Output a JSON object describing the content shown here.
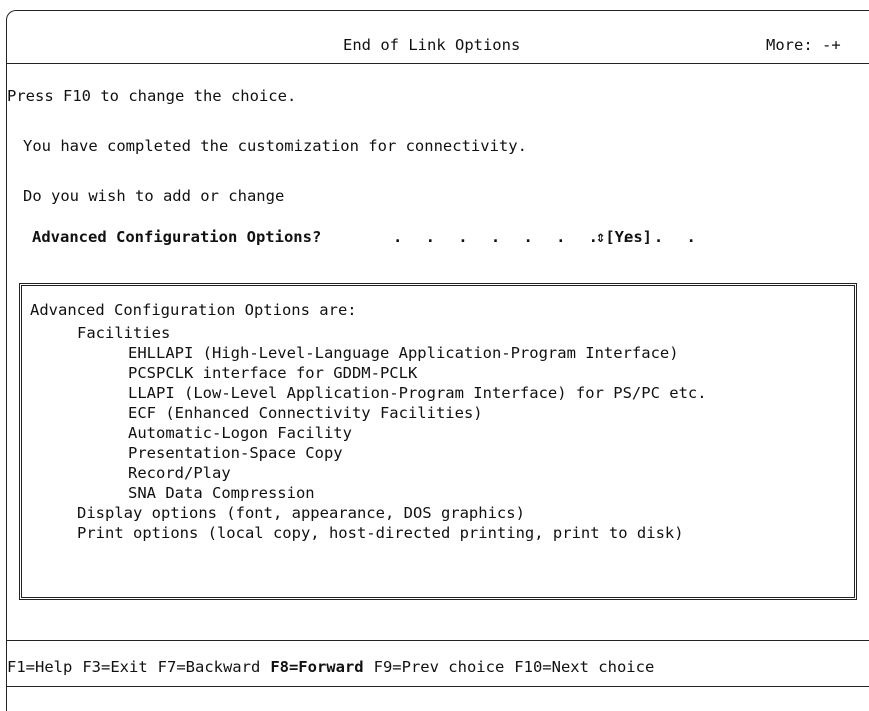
{
  "header": {
    "title": "End of Link Options",
    "more_indicator": "More: -+"
  },
  "instruction": "Press F10 to change the choice.",
  "messages": [
    "You have completed the customization for connectivity.",
    "Do you wish to add or change"
  ],
  "field": {
    "label": "Advanced Configuration Options?",
    "dots": ". . . . . . . . . .",
    "value": "⇕[Yes]"
  },
  "options_box": {
    "heading": "Advanced Configuration Options are:",
    "lines": [
      {
        "indent": 1,
        "text": "Facilities"
      },
      {
        "indent": 2,
        "text": "EHLLAPI (High-Level-Language Application-Program Interface)"
      },
      {
        "indent": 2,
        "text": "PCSPCLK interface for GDDM-PCLK"
      },
      {
        "indent": 2,
        "text": "LLAPI (Low-Level Application-Program Interface) for PS/PC etc."
      },
      {
        "indent": 2,
        "text": "ECF (Enhanced Connectivity Facilities)"
      },
      {
        "indent": 2,
        "text": "Automatic-Logon Facility"
      },
      {
        "indent": 2,
        "text": "Presentation-Space Copy"
      },
      {
        "indent": 2,
        "text": "Record/Play"
      },
      {
        "indent": 2,
        "text": "SNA Data Compression"
      },
      {
        "indent": 1,
        "text": "Display options (font, appearance, DOS graphics)"
      },
      {
        "indent": 1,
        "text": "Print options (local copy, host-directed printing, print to disk)"
      }
    ]
  },
  "function_keys": [
    {
      "label": "F1=Help",
      "bold": false
    },
    {
      "label": "F3=Exit",
      "bold": false
    },
    {
      "label": "F7=Backward",
      "bold": false
    },
    {
      "label": "F8=Forward",
      "bold": true
    },
    {
      "label": "F9=Prev choice",
      "bold": false
    },
    {
      "label": "F10=Next choice",
      "bold": false
    }
  ]
}
